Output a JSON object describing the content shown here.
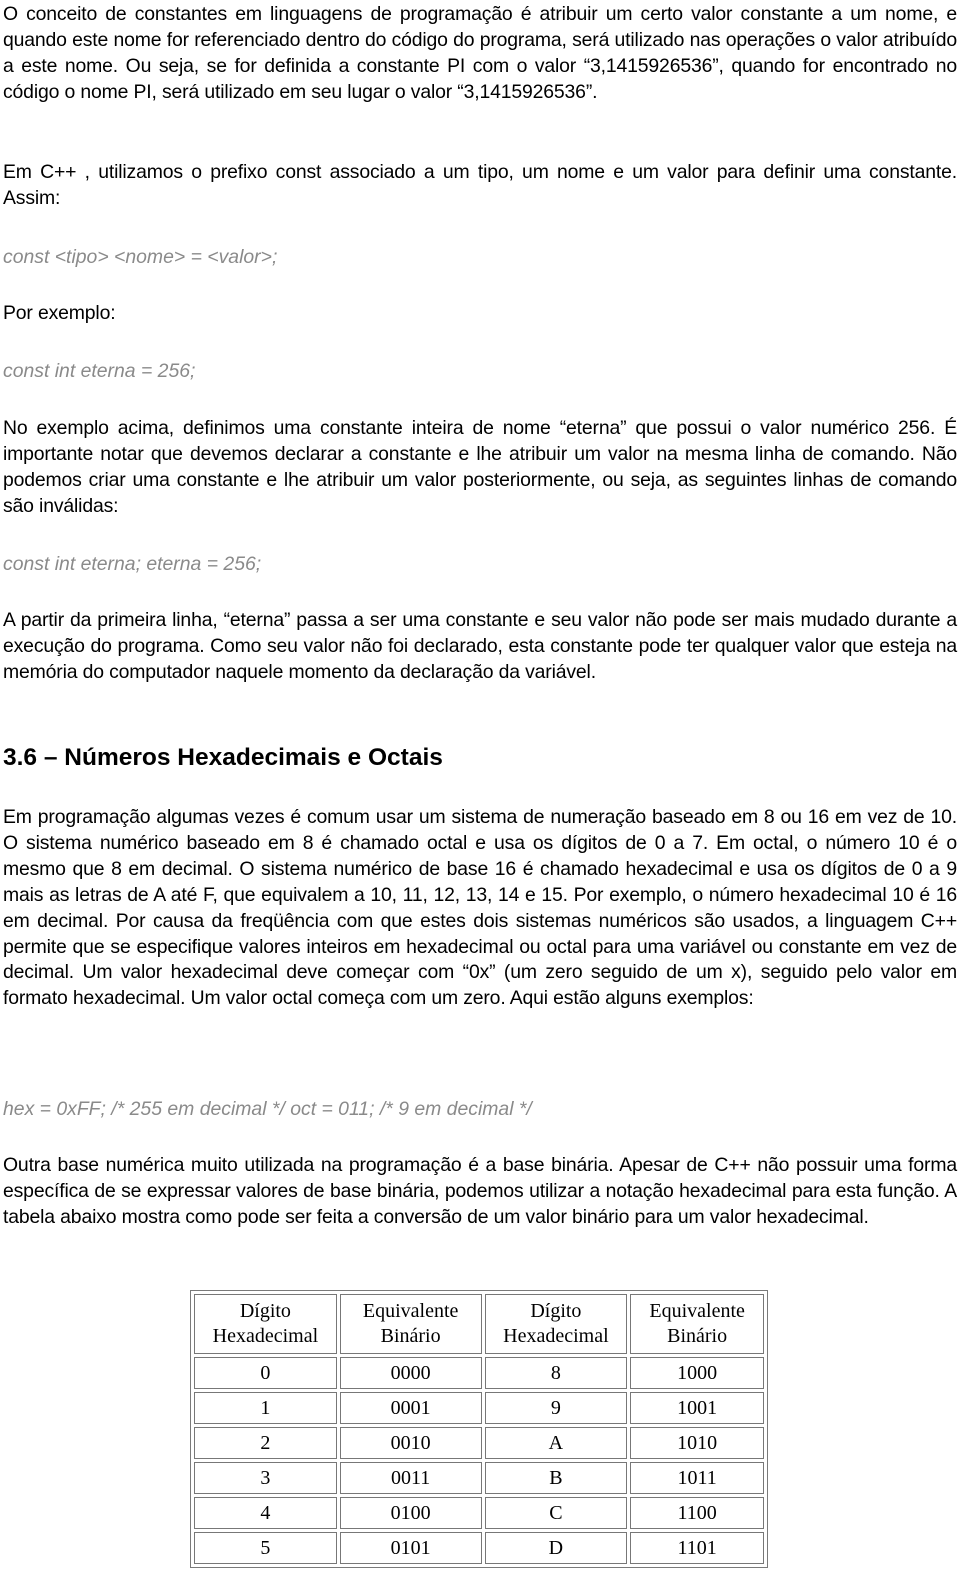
{
  "paragraphs": {
    "p1": "O conceito de constantes em linguagens de programação é atribuir um certo valor constante a um nome, e quando este nome for referenciado dentro do código do programa, será utilizado nas operações o valor atribuído a este nome. Ou seja, se for definida a constante PI com o valor “3,1415926536”, quando for encontrado no código o nome PI, será utilizado em seu lugar o valor “3,1415926536”.",
    "p2": "Em C++ , utilizamos o prefixo const associado a um tipo, um nome e um valor para definir uma constante. Assim:",
    "p3": "Por exemplo:",
    "p4": "No exemplo acima, definimos uma constante inteira de nome “eterna” que possui o valor numérico 256. É importante notar que devemos declarar a constante e lhe atribuir um valor na mesma linha de comando. Não podemos criar uma constante e lhe atribuir um valor posteriormente, ou seja, as seguintes linhas de comando são inválidas:",
    "p5": "A partir da primeira linha, “eterna” passa a ser uma constante e seu valor não pode ser mais mudado durante a execução do programa. Como seu valor não foi declarado, esta constante pode ter qualquer valor que esteja na memória do computador naquele momento da declaração da variável.",
    "p6": "Em programação algumas vezes é comum usar um sistema de numeração baseado em 8 ou 16 em vez de 10. O sistema numérico baseado em 8 é chamado octal e usa os dígitos de 0 a 7. Em octal, o número 10 é o mesmo que 8 em decimal. O sistema numérico de base 16 é chamado hexadecimal e usa os dígitos de 0 a 9 mais as letras de A até F, que equivalem a 10, 11, 12, 13, 14 e 15. Por exemplo, o número hexadecimal 10 é 16 em decimal. Por causa da freqüência com que estes dois sistemas numéricos são usados, a linguagem C++ permite que se especifique valores inteiros em hexadecimal ou octal para uma variável ou constante em vez de decimal. Um valor hexadecimal deve começar com “0x” (um zero seguido de um x), seguido pelo valor em formato hexadecimal. Um valor octal começa com um zero. Aqui estão alguns exemplos:",
    "p7": "Outra base numérica muito utilizada na programação é a base binária. Apesar de C++ não possuir uma forma específica de se expressar valores de base binária, podemos utilizar a notação hexadecimal para esta função. A tabela abaixo mostra como pode ser feita a conversão de um valor binário para um valor hexadecimal."
  },
  "code": {
    "syntax": "const <tipo> <nome> = <valor>;",
    "example": "const int eterna = 256;",
    "invalid": "const int eterna; eterna = 256;",
    "hex_oct": "hex = 0xFF; /* 255 em decimal */ oct = 011; /* 9 em decimal */"
  },
  "section_heading": "3.6 – Números Hexadecimais e Octais",
  "table": {
    "headers": [
      [
        "Dígito",
        "Hexadecimal"
      ],
      [
        "Equivalente",
        "Binário"
      ],
      [
        "Dígito",
        "Hexadecimal"
      ],
      [
        "Equivalente",
        "Binário"
      ]
    ],
    "rows": [
      [
        "0",
        "0000",
        "8",
        "1000"
      ],
      [
        "1",
        "0001",
        "9",
        "1001"
      ],
      [
        "2",
        "0010",
        "A",
        "1010"
      ],
      [
        "3",
        "0011",
        "B",
        "1011"
      ],
      [
        "4",
        "0100",
        "C",
        "1100"
      ],
      [
        "5",
        "0101",
        "D",
        "1101"
      ]
    ]
  },
  "colors": {
    "body_text": "#000000",
    "code_text": "#8a8a8a",
    "table_border": "#777777"
  }
}
